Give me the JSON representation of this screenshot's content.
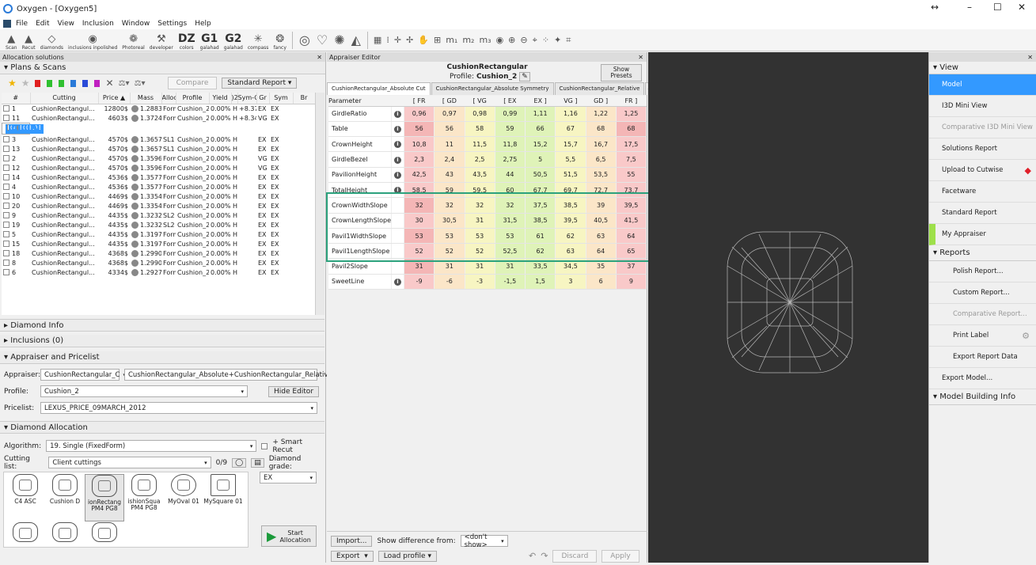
{
  "window": {
    "title": "Oxygen - [Oxygen5]",
    "min": "–",
    "max": "☐",
    "close": "✕",
    "extra": "↔"
  },
  "menu": [
    "File",
    "Edit",
    "View",
    "Inclusion",
    "Window",
    "Settings",
    "Help"
  ],
  "toolbar": [
    {
      "icon": "▲",
      "label": "Scan"
    },
    {
      "icon": "▲",
      "label": "Recut"
    },
    {
      "icon": "◇",
      "label": "diamonds"
    },
    {
      "icon": "◉",
      "label": "inclusions inpolished"
    },
    {
      "icon": "❁",
      "label": "Photoreal"
    },
    {
      "icon": "⚒",
      "label": "developer"
    },
    {
      "big": "DZ",
      "label": "colors"
    },
    {
      "big": "G1",
      "label": "galahad"
    },
    {
      "big": "G2",
      "label": "galahad"
    },
    {
      "icon": "✳",
      "label": "compass"
    },
    {
      "icon": "❂",
      "label": "fancy"
    }
  ],
  "left": {
    "panel_title": "Allocation solutions",
    "plans_title": "Plans & Scans",
    "compare": "Compare",
    "standard_report": "Standard Report",
    "columns": [
      "#",
      "Cutting",
      "Price ▲",
      "Mass",
      "Alloc",
      "Profile",
      "Yield",
      ")2",
      "Sym-O",
      "Gr",
      "Sym",
      "Br"
    ],
    "rows": [
      [
        "1",
        "CushionRectangul...",
        "12800$",
        "1.2883",
        "Form",
        "Cushion_2",
        "0.00%",
        "H",
        "+8.37",
        "EX",
        "EX"
      ],
      [
        "11",
        "CushionRectangul...",
        "4603$",
        "1.3724",
        "Form",
        "Cushion_2",
        "0.00%",
        "H",
        "+8.34",
        "VG",
        "EX"
      ],
      [
        "21",
        "CushionRectangul...",
        "4603$",
        "1.3724",
        "Form",
        "Cushion_2",
        "0.00%",
        "H",
        "...",
        "VG",
        "EX"
      ],
      [
        "3",
        "CushionRectangul...",
        "4570$",
        "1.3657",
        "SL1",
        "Cushion_2",
        "0.00%",
        "H",
        "",
        "EX",
        "EX"
      ],
      [
        "13",
        "CushionRectangul...",
        "4570$",
        "1.3657",
        "SL1",
        "Cushion_2",
        "0.00%",
        "H",
        "",
        "EX",
        "EX"
      ],
      [
        "2",
        "CushionRectangul...",
        "4570$",
        "1.3596",
        "Form",
        "Cushion_2",
        "0.00%",
        "H",
        "",
        "VG",
        "EX"
      ],
      [
        "12",
        "CushionRectangul...",
        "4570$",
        "1.3596",
        "Form",
        "Cushion_2",
        "0.00%",
        "H",
        "",
        "VG",
        "EX"
      ],
      [
        "14",
        "CushionRectangul...",
        "4536$",
        "1.3577",
        "Form",
        "Cushion_2",
        "0.00%",
        "H",
        "",
        "EX",
        "EX"
      ],
      [
        "4",
        "CushionRectangul...",
        "4536$",
        "1.3577",
        "Form",
        "Cushion_2",
        "0.00%",
        "H",
        "",
        "EX",
        "EX"
      ],
      [
        "10",
        "CushionRectangul...",
        "4469$",
        "1.3354",
        "Form",
        "Cushion_2",
        "0.00%",
        "H",
        "",
        "EX",
        "EX"
      ],
      [
        "20",
        "CushionRectangul...",
        "4469$",
        "1.3354",
        "Form",
        "Cushion_2",
        "0.00%",
        "H",
        "",
        "EX",
        "EX"
      ],
      [
        "9",
        "CushionRectangul...",
        "4435$",
        "1.3232",
        "SL2",
        "Cushion_2",
        "0.00%",
        "H",
        "",
        "EX",
        "EX"
      ],
      [
        "19",
        "CushionRectangul...",
        "4435$",
        "1.3232",
        "SL2",
        "Cushion_2",
        "0.00%",
        "H",
        "",
        "EX",
        "EX"
      ],
      [
        "5",
        "CushionRectangul...",
        "4435$",
        "1.3197",
        "Form",
        "Cushion_2",
        "0.00%",
        "H",
        "",
        "EX",
        "EX"
      ],
      [
        "15",
        "CushionRectangul...",
        "4435$",
        "1.3197",
        "Form",
        "Cushion_2",
        "0.00%",
        "H",
        "",
        "EX",
        "EX"
      ],
      [
        "18",
        "CushionRectangul...",
        "4368$",
        "1.2990",
        "Form",
        "Cushion_2",
        "0.00%",
        "H",
        "",
        "EX",
        "EX"
      ],
      [
        "8",
        "CushionRectangul...",
        "4368$",
        "1.2990",
        "Form",
        "Cushion_2",
        "0.00%",
        "H",
        "",
        "EX",
        "EX"
      ]
    ],
    "partial_row": [
      "6",
      "CushionRectangul...",
      "4334$",
      "1.2927",
      "Form",
      "Cushion_2",
      "0.00%",
      "H",
      "",
      "EX",
      "EX"
    ],
    "diamond_info": "Diamond Info",
    "inclusions": "Inclusions (0)",
    "appraiser_pricelist": "Appraiser and Pricelist",
    "appraiser_label": "Appraiser:",
    "appraiser_val1": "CushionRectangular_C",
    "appraiser_val2": "CushionRectangular_Absolute+CushionRectangular_Relative",
    "profile_label": "Profile:",
    "profile_val": "Cushion_2",
    "hide_editor": "Hide Editor",
    "pricelist_label": "Pricelist:",
    "pricelist_val": "LEXUS_PRICE_09MARCH_2012",
    "diamond_alloc": "Diamond Allocation",
    "algorithm_label": "Algorithm:",
    "algorithm_val": "19. Single (FixedForm)",
    "smart_recut": "+ Smart Recut",
    "cutting_label": "Cutting list:",
    "cutting_val": "Client cuttings",
    "cutting_count": "0/9",
    "grade_label": "Diamond grade:",
    "grade_val": "EX",
    "gems": [
      "C4 ASC",
      "Cushion D",
      "ionRectang PM4 PG8",
      "ishionSqua PM4 PG8",
      "MyOval 01",
      "MySquare 01"
    ],
    "start": "Start Allocation"
  },
  "editor": {
    "panel_title": "Appraiser Editor",
    "name": "CushionRectangular",
    "profile_label": "Profile:",
    "profile_val": "Cushion_2",
    "show_presets": "Show Presets",
    "tabs": [
      "CushionRectangular_Absolute Cut",
      "CushionRectangular_Absolute Symmetry",
      "CushionRectangular_Relative"
    ],
    "headers": [
      "Parameter",
      "",
      "[ FR",
      "[ GD",
      "[ VG",
      "[ EX",
      "EX ]",
      "VG ]",
      "GD ]",
      "FR ]"
    ],
    "rows": [
      {
        "name": "GirdleRatio",
        "info": true,
        "v": [
          "0,96",
          "0,97",
          "0,98",
          "0,99",
          "1,11",
          "1,16",
          "1,22",
          "1,25"
        ],
        "c": [
          "r",
          "o",
          "y",
          "g",
          "g",
          "y",
          "o",
          "r"
        ]
      },
      {
        "name": "Table",
        "info": true,
        "v": [
          "56",
          "56",
          "58",
          "59",
          "66",
          "67",
          "68",
          "68"
        ],
        "c": [
          "r2",
          "o",
          "y",
          "g",
          "g",
          "y",
          "o",
          "r2"
        ]
      },
      {
        "name": "CrownHeight",
        "info": true,
        "v": [
          "10,8",
          "11",
          "11,5",
          "11,8",
          "15,2",
          "15,7",
          "16,7",
          "17,5"
        ],
        "c": [
          "r",
          "o",
          "y",
          "g",
          "g",
          "y",
          "o",
          "r"
        ]
      },
      {
        "name": "GirdleBezel",
        "info": true,
        "v": [
          "2,3",
          "2,4",
          "2,5",
          "2,75",
          "5",
          "5,5",
          "6,5",
          "7,5"
        ],
        "c": [
          "r",
          "o",
          "y",
          "g",
          "g",
          "y",
          "o",
          "r"
        ]
      },
      {
        "name": "PavilionHeight",
        "info": true,
        "v": [
          "42,5",
          "43",
          "43,5",
          "44",
          "50,5",
          "51,5",
          "53,5",
          "55"
        ],
        "c": [
          "r",
          "o",
          "y",
          "g",
          "g",
          "y",
          "o",
          "r"
        ]
      },
      {
        "name": "TotalHeight",
        "info": true,
        "v": [
          "58,5",
          "59",
          "59,5",
          "60",
          "67,7",
          "69,7",
          "72,7",
          "73,7"
        ],
        "c": [
          "r",
          "o",
          "y",
          "g",
          "g",
          "y",
          "o",
          "r"
        ]
      },
      {
        "name": "CrownWidthSlope",
        "info": false,
        "v": [
          "32",
          "32",
          "32",
          "32",
          "37,5",
          "38,5",
          "39",
          "39,5"
        ],
        "c": [
          "r2",
          "o",
          "y",
          "g",
          "g",
          "y",
          "o",
          "r"
        ]
      },
      {
        "name": "CrownLengthSlope",
        "info": false,
        "v": [
          "30",
          "30,5",
          "31",
          "31,5",
          "38,5",
          "39,5",
          "40,5",
          "41,5"
        ],
        "c": [
          "r",
          "o",
          "y",
          "g",
          "g",
          "y",
          "o",
          "r"
        ]
      },
      {
        "name": "Pavil1WidthSlope",
        "info": false,
        "v": [
          "53",
          "53",
          "53",
          "53",
          "61",
          "62",
          "63",
          "64"
        ],
        "c": [
          "r2",
          "o",
          "y",
          "g",
          "g",
          "y",
          "o",
          "r"
        ]
      },
      {
        "name": "Pavil1LengthSlope",
        "info": false,
        "v": [
          "52",
          "52",
          "52",
          "52,5",
          "62",
          "63",
          "64",
          "65"
        ],
        "c": [
          "r",
          "o",
          "y",
          "g",
          "g",
          "y",
          "o",
          "r"
        ]
      },
      {
        "name": "Pavil2Slope",
        "info": false,
        "v": [
          "31",
          "31",
          "31",
          "31",
          "33,5",
          "34,5",
          "35",
          "37"
        ],
        "c": [
          "r2",
          "o",
          "y",
          "g",
          "g",
          "y",
          "o",
          "r"
        ]
      },
      {
        "name": "SweetLine",
        "info": true,
        "v": [
          "-9",
          "-6",
          "-3",
          "-1,5",
          "1,5",
          "3",
          "6",
          "9"
        ],
        "c": [
          "r",
          "o",
          "y",
          "g",
          "g",
          "y",
          "o",
          "r"
        ]
      }
    ],
    "import": "Import...",
    "showdiff": "Show difference from:",
    "dontshow": "<don't show>",
    "export": "Export",
    "loadprofile": "Load profile",
    "discard": "Discard",
    "apply": "Apply"
  },
  "right": {
    "view": "View",
    "items": [
      "Model",
      "I3D Mini View",
      "Comparative I3D Mini View",
      "Solutions Report",
      "Upload to Cutwise",
      "Facetware",
      "Standard Report",
      "My Appraiser"
    ],
    "reports": "Reports",
    "report_items": [
      "Polish Report...",
      "Custom Report...",
      "Comparative Report...",
      "Print Label",
      "Export Report Data"
    ],
    "export_model": "Export Model...",
    "model_building": "Model Building Info"
  }
}
